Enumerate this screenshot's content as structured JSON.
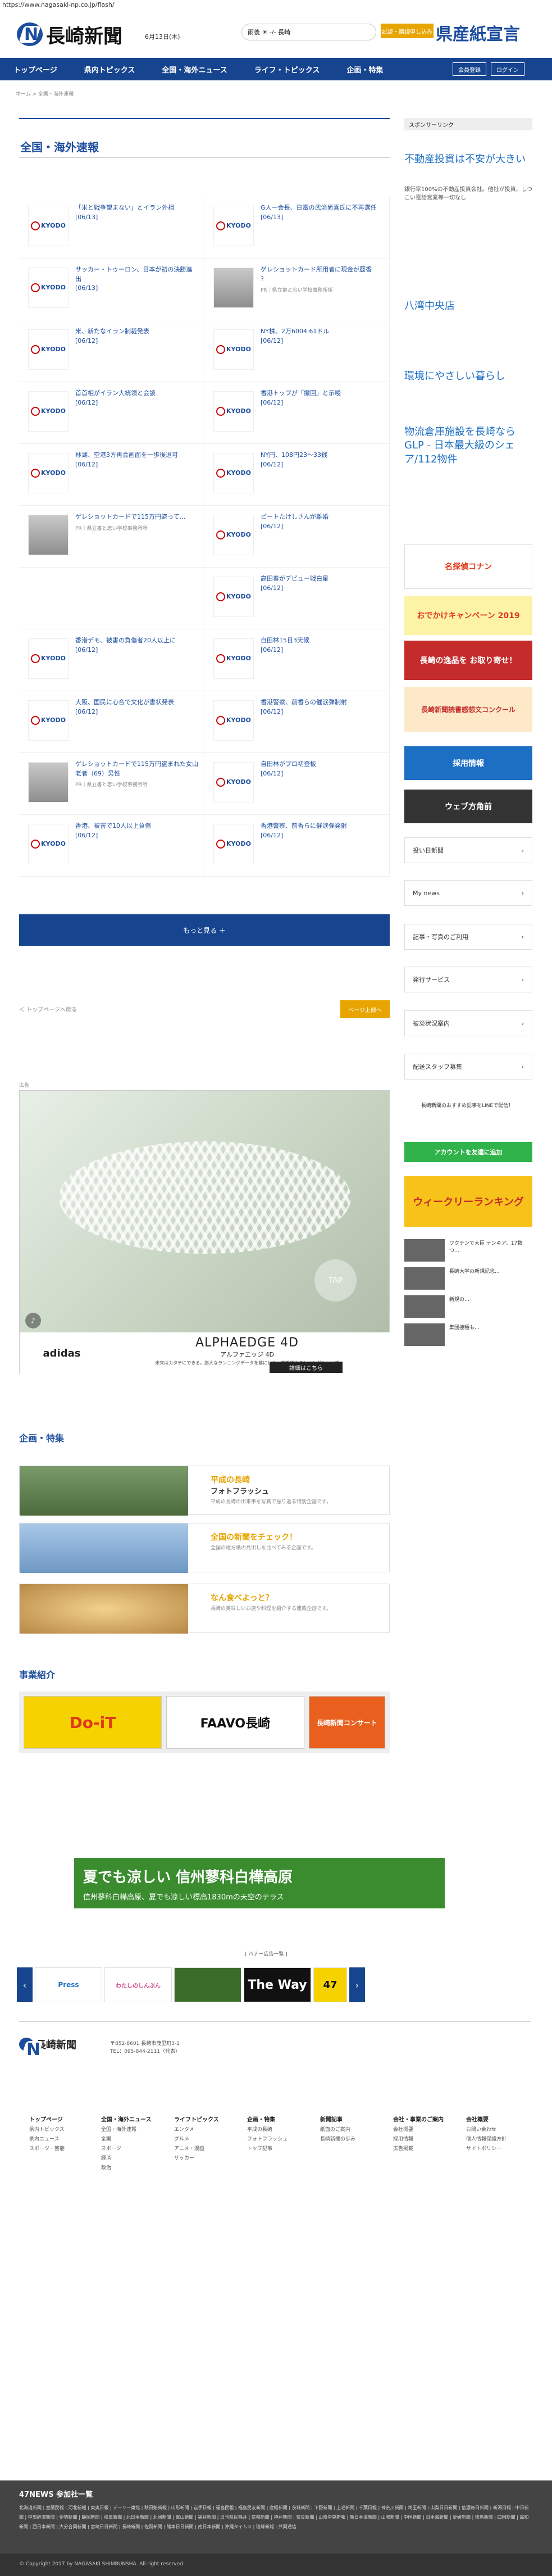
{
  "browser": {
    "url": "https://www.nagasaki-np.co.jp/flash/"
  },
  "header": {
    "logo_text": "長崎新聞",
    "date": "6月13日(木)",
    "weather": "雨後 ☀ -/- 長崎",
    "trial_label": "試読・購読申し込み",
    "pref_logo": "県産紙宣言"
  },
  "nav": {
    "items": [
      "トップページ",
      "県内トピックス",
      "全国・海外ニュース",
      "ライフ・トピックス",
      "企画・特集"
    ],
    "login": "会員登録",
    "right": "ログイン"
  },
  "breadcrumb": "ホーム > 全国・海外速報",
  "page_title": "全国・海外速報",
  "news": [
    {
      "t": "「米と戦争望まない」とイラン外相",
      "d": "[06/13]",
      "img": "kyodo"
    },
    {
      "t": "G人一会長、日電の武治尚喜氏に不再選任",
      "d": "[06/13]",
      "img": "kyodo"
    },
    {
      "t": "サッカー・トゥーロン、日本が初の決勝進出",
      "d": "[06/13]",
      "img": "kyodo"
    },
    {
      "t": "ゲレショットカード所用者に現金が歴香",
      "d": "?",
      "src": "PR｜県立書と忠い学校事務所所",
      "img": "photo"
    },
    {
      "t": "米、新たなイラン制裁発表",
      "d": "[06/12]",
      "img": "kyodo"
    },
    {
      "t": "NY株、2万6004.61ドル",
      "d": "[06/12]",
      "img": "kyodo"
    },
    {
      "t": "首首相がイラン大統領と会談",
      "d": "[06/12]",
      "img": "kyodo"
    },
    {
      "t": "香港トップが「撤回」と示唆",
      "d": "[06/12]",
      "img": "kyodo"
    },
    {
      "t": "林湖、空港3方再会画面を一歩後退可",
      "d": "[06/12]",
      "img": "kyodo"
    },
    {
      "t": "NY円、108円23～33銭",
      "d": "[06/12]",
      "img": "kyodo"
    },
    {
      "t": "ゲレショットカードで115万円盗って…",
      "d": "",
      "src": "PR｜県立書と忠い学校事務所所",
      "img": "photo"
    },
    {
      "t": "ピートたけしさんが離婚",
      "d": "[06/12]",
      "img": "kyodo"
    },
    {
      "t": "",
      "d": "",
      "img": ""
    },
    {
      "t": "高田春がデビュー戦白星",
      "d": "[06/12]",
      "img": "kyodo"
    },
    {
      "t": "香港デモ、被害の負傷者20人以上に",
      "d": "[06/12]",
      "img": "kyodo"
    },
    {
      "t": "自田林15日3天候",
      "d": "[06/12]",
      "img": "kyodo"
    },
    {
      "t": "大阪、国民に心合で文化が書状発表",
      "d": "[06/12]",
      "img": "kyodo"
    },
    {
      "t": "香港警察、前香らの催涙弾制射",
      "d": "[06/12]",
      "img": "kyodo"
    },
    {
      "t": "ゲレショットカードで115万円盗まれた女山老者（69）男性",
      "d": "",
      "src": "PR｜県立書と忠い学校事務所所",
      "img": "photo"
    },
    {
      "t": "自田林がプロ初登板",
      "d": "[06/12]",
      "img": "kyodo"
    },
    {
      "t": "香港、被害で10人以上負傷",
      "d": "[06/12]",
      "img": "kyodo"
    },
    {
      "t": "香港警察、前香らに催涙弾発射",
      "d": "[06/12]",
      "img": "kyodo"
    }
  ],
  "more_label": "もっと見る ＋",
  "pager": {
    "prev": "＜ トップページへ戻る",
    "next": "ページ上部へ"
  },
  "ad": {
    "label": "広告",
    "brand": "adidas",
    "product": "ALPHAEDGE 4D",
    "sub": "アルファエッジ 4D",
    "desc": "未来はカタチにできる。膨大なランニングデータを基にした、革新的なランニングシューズ",
    "cta": "詳細はこちら",
    "tap": "TAP"
  },
  "features": {
    "title": "企画・特集",
    "items": [
      {
        "t": "平成の長崎",
        "s": "フォトフラッシュ",
        "d": "平成の長崎の出来事を写真で振り返る特別企画です。"
      },
      {
        "t": "全国の新聞をチェック！",
        "s": "",
        "d": "全国の地方紙の見出しを比べてみる企画です。"
      },
      {
        "t": "なん食べよっと？",
        "s": "",
        "d": "長崎の美味しいお店や料理を紹介する連載企画です。"
      }
    ]
  },
  "biz": {
    "title": "事業紹介",
    "items": [
      "Do-iT",
      "FAAVO長崎",
      "長崎新聞コンサート"
    ]
  },
  "banner": {
    "line1": "夏でも涼しい 信州蓼科白樺高原",
    "line2": "信州蓼科白樺高原、夏でも涼しい標高1830mの天空のテラス"
  },
  "partners": {
    "label": "[ バナー広告一覧 ]",
    "items": [
      "Press",
      "わたしのしんぶん",
      "",
      "The Way",
      "47"
    ]
  },
  "sidebar": {
    "sponsor": "スポンサーリンク",
    "ads": [
      "不動産投資は不安が大きい",
      "八湾中央店",
      "環境にやさしい暮らし",
      "物流倉庫施設を長崎ならGLP - 日本最大級のシェア/112物件"
    ],
    "ad_subs": [
      "銀行率100%の不動産投資会社。他社が投資、しつこい電話営業等一切なし",
      "",
      "",
      ""
    ],
    "banners": [
      "おでかけキャンペーン 2019",
      "長崎の逸品を お取り寄せ！",
      "長崎新聞読書感想文コンクール"
    ],
    "buttons": [
      "採用情報",
      "ウェブ方角前",
      "投い日新聞",
      "My news",
      "記事・写真のご利用",
      "発行サービス",
      "被災状況案内",
      "配送スタッフ募集"
    ],
    "line": "長崎新聞のおすすめ記事をLINEで配信！",
    "line_btn": "アカウントを友達に追加",
    "ranking": "ウィークリーランキング",
    "picks": [
      "ワクチンで大臣 テンキア、17数つ…",
      "長崎大学の新規記念...",
      "新規の…",
      "集団接種も…"
    ]
  },
  "footer": {
    "company": "長崎新聞",
    "address": "〒852-8601 長崎市茂里町3-1",
    "tel": "TEL：095-844-2111（代表）",
    "cols": [
      {
        "h": "トップページ",
        "items": [
          "県内トピックス",
          "県内ニュース",
          "スポーツ・芸能"
        ]
      },
      {
        "h": "全国・海外ニュース",
        "items": [
          "全国・海外速報",
          "全国",
          "スポーツ",
          "経済",
          "政治"
        ]
      },
      {
        "h": "ライフトピックス",
        "items": [
          "エンタメ",
          "グルメ",
          "アニメ・漫画",
          "サッカー"
        ]
      },
      {
        "h": "企画・特集",
        "items": [
          "平成の長崎",
          "フォトフラッシュ",
          "トップ記事"
        ]
      },
      {
        "h": "新聞記事",
        "items": [
          "紙面のご案内",
          "長崎新聞の歩み"
        ]
      },
      {
        "h": "会社・事業のご案内",
        "items": [
          "会社概要",
          "採用情報",
          "広告掲載"
        ]
      },
      {
        "h": "会社概要",
        "items": [
          "お問い合わせ",
          "個人情報保護方針",
          "サイトポリシー"
        ]
      }
    ],
    "news47": "47NEWS 参加社一覧",
    "news47_list": "北海道新聞 | 室蘭民報 | 河北新報 | 東奥日報 | デーリー東北 | 秋田魁新報 | 山形新聞 | 岩手日報 | 福島民報 | 福島民友新聞 | 産経新聞 | 茨城新聞 | 下野新聞 | 上毛新聞 | 千葉日報 | 神奈川新聞 | 埼玉新聞 | 山梨日日新聞 | 信濃毎日新聞 | 新潟日報 | 中日新聞 | 中部経済新聞 | 伊勢新聞 | 静岡新聞 | 岐阜新聞 | 北日本新聞 | 北國新聞 | 富山新聞 | 福井新聞 | 日刊県民福井 | 京都新聞 | 神戸新聞 | 奈良新聞 | 山陰中央新報 | 新日本海新聞 | 山陽新聞 | 中国新聞 | 日本海新聞 | 愛媛新聞 | 徳島新聞 | 四国新聞 | 高知新聞 | 西日本新聞 | 大分合同新聞 | 宮崎日日新聞 | 長崎新聞 | 佐賀新聞 | 熊本日日新聞 | 南日本新聞 | 沖縄タイムス | 琉球新報 | 共同通信",
    "copyright": "© Copyright 2017 by NAGASAKI SHIMBUNSHA. All right reserved."
  }
}
